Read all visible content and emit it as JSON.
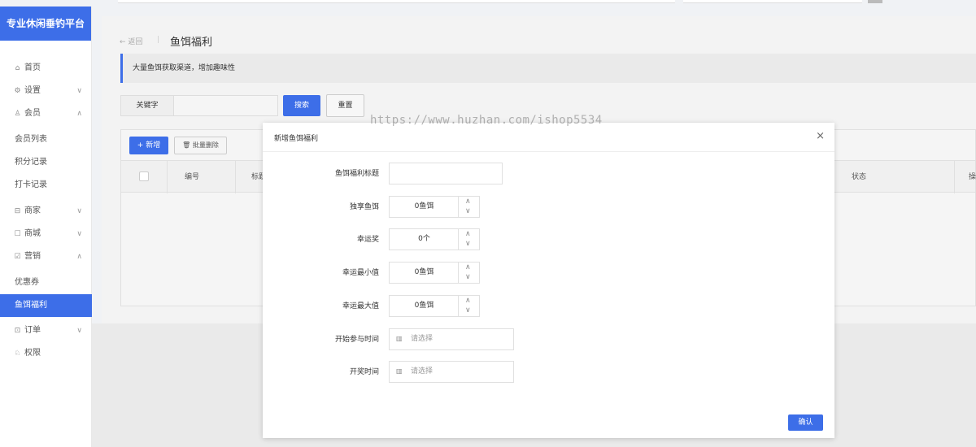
{
  "sidebar": {
    "logo": "专业休闲垂钓平台",
    "items": [
      {
        "label": "首页",
        "icon": "home-icon"
      },
      {
        "label": "设置",
        "icon": "gear-icon"
      },
      {
        "label": "会员",
        "icon": "user-icon"
      },
      {
        "label": "会员列表"
      },
      {
        "label": "积分记录"
      },
      {
        "label": "打卡记录"
      },
      {
        "label": "商家",
        "icon": "store-icon"
      },
      {
        "label": "商城",
        "icon": "shop-icon"
      },
      {
        "label": "营销",
        "icon": "marketing-icon"
      },
      {
        "label": "优惠券"
      },
      {
        "label": "鱼饵福利"
      },
      {
        "label": "订单",
        "icon": "order-icon"
      },
      {
        "label": "权限",
        "icon": "permission-icon"
      }
    ]
  },
  "header": {
    "back": "← 返回",
    "separator": "|",
    "title": "鱼饵福利"
  },
  "notice": "大量鱼饵获取渠道，增加趣味性",
  "search": {
    "keyword_label": "关键字",
    "keyword_value": "",
    "search_label": "搜索",
    "reset_label": "重置"
  },
  "toolbar": {
    "add_label": "+ 新增",
    "batch_delete_label": "批量删除"
  },
  "table": {
    "columns": [
      "编号",
      "标题",
      "状态",
      "操"
    ]
  },
  "modal": {
    "title": "新增鱼饵福利",
    "close": "×",
    "fields": [
      {
        "label": "鱼饵福利标题",
        "value": ""
      },
      {
        "label": "独享鱼饵",
        "value": "0鱼饵"
      },
      {
        "label": "幸运奖",
        "value": "0个"
      },
      {
        "label": "幸运最小值",
        "value": "0鱼饵"
      },
      {
        "label": "幸运最大值",
        "value": "0鱼饵"
      },
      {
        "label": "开始参与时间",
        "placeholder": "请选择"
      },
      {
        "label": "开奖时间",
        "placeholder": "请选择"
      }
    ],
    "confirm_label": "确认"
  },
  "watermark": "https://www.huzhan.com/ishop5534",
  "colors": {
    "accent": "#3d6ee8"
  }
}
